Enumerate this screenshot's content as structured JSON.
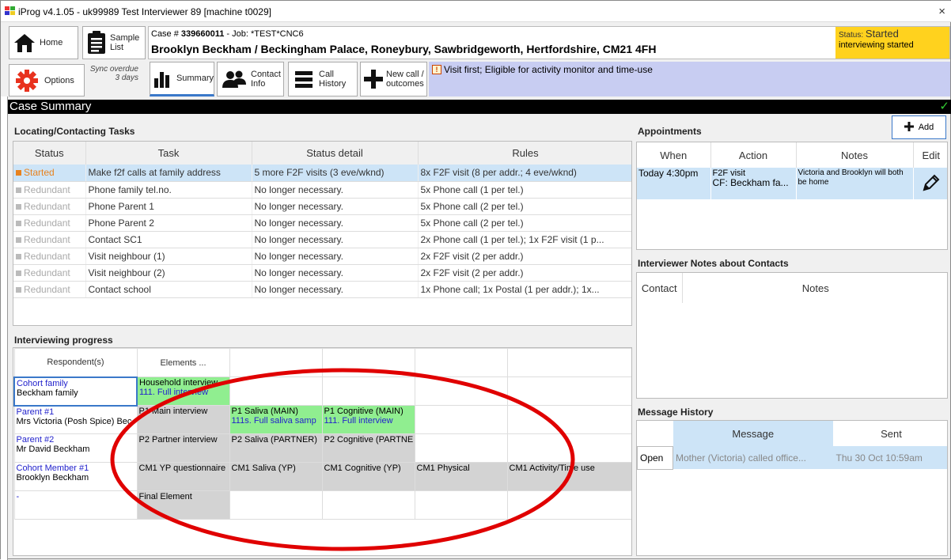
{
  "window": {
    "title": "iProg v4.1.05 - uk99989 Test Interviewer 89 [machine t0029]",
    "close": "×"
  },
  "toolbar": {
    "home": "Home",
    "sample_list": "Sample List",
    "options": "Options",
    "sync_status": "Sync overdue 3 days",
    "summary": "Summary",
    "contact_info": "Contact Info",
    "call_history": "Call History",
    "new_call": "New call / outcomes"
  },
  "case": {
    "prefix": "Case # ",
    "number": "339660011",
    "job": " - Job: *TEST*CNC6",
    "address": "Brooklyn Beckham / Beckingham Palace, Roneybury, Sawbridgeworth, Hertfordshire, CM21 4FH"
  },
  "status": {
    "label": "Status: ",
    "value": "Started",
    "detail": "interviewing started"
  },
  "flag": {
    "icon": "!",
    "text": "Visit first; Eligible for activity monitor and time-use"
  },
  "page_title": "Case Summary",
  "tasks": {
    "title": "Locating/Contacting Tasks",
    "headers": [
      "Status",
      "Task",
      "Status detail",
      "Rules"
    ],
    "rows": [
      [
        "Started",
        "Make f2f calls at family address",
        "5 more F2F visits (3 eve/wknd)",
        "8x F2F visit (8 per addr.; 4 eve/wknd)"
      ],
      [
        "Redundant",
        "Phone family tel.no.",
        "No longer necessary.",
        "5x Phone call (1 per tel.)"
      ],
      [
        "Redundant",
        "Phone Parent 1",
        "No longer necessary.",
        "5x Phone call (2 per tel.)"
      ],
      [
        "Redundant",
        "Phone Parent 2",
        "No longer necessary.",
        "5x Phone call (2 per tel.)"
      ],
      [
        "Redundant",
        "Contact SC1",
        "No longer necessary.",
        "2x Phone call (1 per tel.); 1x F2F visit (1 p..."
      ],
      [
        "Redundant",
        "Visit neighbour (1)",
        "No longer necessary.",
        "2x F2F visit (2 per addr.)"
      ],
      [
        "Redundant",
        "Visit neighbour (2)",
        "No longer necessary.",
        "2x F2F visit (2 per addr.)"
      ],
      [
        "Redundant",
        "Contact school",
        "No longer necessary.",
        "1x Phone call; 1x Postal (1 per addr.); 1x..."
      ]
    ]
  },
  "progress": {
    "title": "Interviewing progress",
    "headers": [
      "Respondent(s)",
      "Elements ..."
    ],
    "rows": [
      {
        "role": "Cohort family",
        "name": "Beckham family",
        "cells": [
          {
            "t": "Household interview",
            "s": "111. Full interview",
            "c": "green"
          },
          {
            "t": "",
            "s": "",
            "c": ""
          },
          {
            "t": "",
            "s": "",
            "c": ""
          },
          {
            "t": "",
            "s": "",
            "c": ""
          },
          {
            "t": "",
            "s": "",
            "c": ""
          }
        ]
      },
      {
        "role": "Parent #1",
        "name": "Mrs Victoria (Posh Spice) Bec",
        "cells": [
          {
            "t": "P1 Main interview",
            "s": "",
            "c": "grey"
          },
          {
            "t": "P1 Saliva (MAIN)",
            "s": "111s. Full saliva samp",
            "c": "green"
          },
          {
            "t": "P1 Cognitive (MAIN)",
            "s": "111. Full interview",
            "c": "green"
          },
          {
            "t": "",
            "s": "",
            "c": ""
          },
          {
            "t": "",
            "s": "",
            "c": ""
          }
        ]
      },
      {
        "role": "Parent #2",
        "name": "Mr David Beckham",
        "cells": [
          {
            "t": "P2 Partner interview",
            "s": "",
            "c": "grey"
          },
          {
            "t": "P2 Saliva (PARTNER)",
            "s": "",
            "c": "grey"
          },
          {
            "t": "P2 Cognitive (PARTNE",
            "s": "",
            "c": "grey"
          },
          {
            "t": "",
            "s": "",
            "c": ""
          },
          {
            "t": "",
            "s": "",
            "c": ""
          }
        ]
      },
      {
        "role": "Cohort Member #1",
        "name": "Brooklyn Beckham",
        "cells": [
          {
            "t": "CM1 YP questionnaire",
            "s": "",
            "c": "grey"
          },
          {
            "t": "CM1 Saliva (YP)",
            "s": "",
            "c": "grey"
          },
          {
            "t": "CM1 Cognitive (YP)",
            "s": "",
            "c": "grey"
          },
          {
            "t": "CM1 Physical",
            "s": "",
            "c": "grey"
          },
          {
            "t": "CM1 Activity/Time use",
            "s": "",
            "c": "grey"
          }
        ]
      },
      {
        "role": "-",
        "name": "",
        "cells": [
          {
            "t": "Final Element",
            "s": "",
            "c": "grey"
          },
          {
            "t": "",
            "s": "",
            "c": ""
          },
          {
            "t": "",
            "s": "",
            "c": ""
          },
          {
            "t": "",
            "s": "",
            "c": ""
          },
          {
            "t": "",
            "s": "",
            "c": ""
          }
        ]
      }
    ]
  },
  "appointments": {
    "title": "Appointments",
    "add": "Add",
    "headers": [
      "When",
      "Action",
      "Notes",
      "Edit"
    ],
    "rows": [
      {
        "when": "Today 4:30pm",
        "action1": "F2F visit",
        "action2": "CF: Beckham fa...",
        "notes": "Victoria and Brooklyn will both be home"
      }
    ]
  },
  "notes": {
    "title": "Interviewer Notes about Contacts",
    "headers": [
      "Contact",
      "Notes"
    ]
  },
  "messages": {
    "title": "Message History",
    "headers": [
      "",
      "Message",
      "Sent"
    ],
    "rows": [
      [
        "Open",
        "Mother (Victoria) called office...",
        "Thu 30 Oct 10:59am"
      ]
    ]
  },
  "colors": {
    "accent_blue": "#cde4f7",
    "status_yellow": "#ffd21e",
    "flag_bg": "#c8cdf2",
    "started": "#e8821e",
    "annotation": "#e00000"
  },
  "icons": [
    "home-icon",
    "clipboard-icon",
    "gear-icon",
    "bar-chart-icon",
    "people-icon",
    "list-icon",
    "plus-icon",
    "pencil-icon",
    "warning-icon",
    "checkmark-icon"
  ]
}
